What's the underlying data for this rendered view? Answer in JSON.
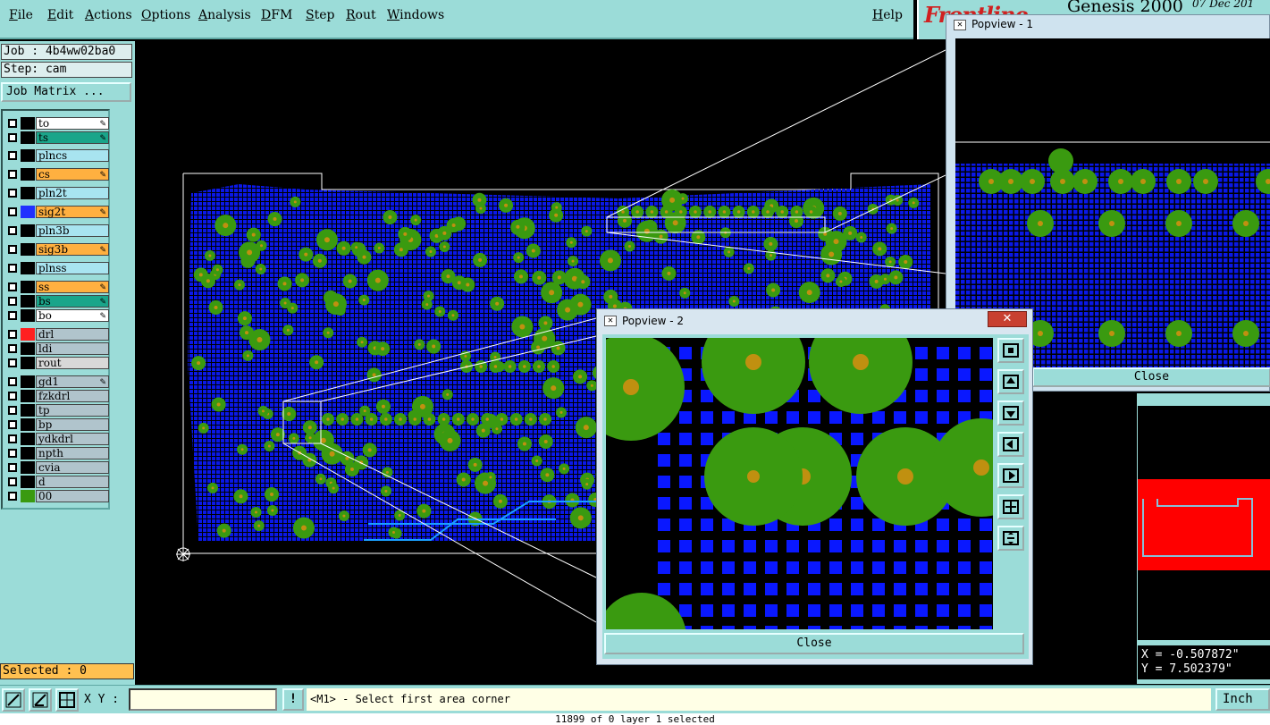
{
  "menubar": {
    "menus": [
      "File",
      "Edit",
      "Actions",
      "Options",
      "Analysis",
      "DFM",
      "Step",
      "Rout",
      "Windows"
    ],
    "help": "Help"
  },
  "brand": {
    "logo": "Frontline",
    "product": "Genesis 2000",
    "date": "07 Dec 201"
  },
  "job": {
    "label": "Job : 4b4ww02ba0",
    "step": "Step: cam",
    "matrix_button": "Job Matrix ..."
  },
  "layers": [
    {
      "name": "to",
      "color": "#ffffff",
      "swatch": "#000000",
      "pen": true
    },
    {
      "name": "ts",
      "color": "#1aa58a",
      "swatch": "#000000",
      "pen": true
    },
    {
      "name": "plncs",
      "color": "#a8e4f0",
      "swatch": "#000000",
      "pen": false
    },
    {
      "name": "cs",
      "color": "#ffb040",
      "swatch": "#000000",
      "pen": true
    },
    {
      "name": "pln2t",
      "color": "#a8e4f0",
      "swatch": "#000000",
      "pen": false
    },
    {
      "name": "sig2t",
      "color": "#ffb040",
      "swatch": "#2030ff",
      "pen": true
    },
    {
      "name": "pln3b",
      "color": "#a8e4f0",
      "swatch": "#000000",
      "pen": false
    },
    {
      "name": "sig3b",
      "color": "#ffb040",
      "swatch": "#000000",
      "pen": true
    },
    {
      "name": "plnss",
      "color": "#a8e4f0",
      "swatch": "#000000",
      "pen": false
    },
    {
      "name": "ss",
      "color": "#ffb040",
      "swatch": "#000000",
      "pen": true
    },
    {
      "name": "bs",
      "color": "#1aa58a",
      "swatch": "#000000",
      "pen": true
    },
    {
      "name": "bo",
      "color": "#ffffff",
      "swatch": "#000000",
      "pen": true
    },
    {
      "name": "drl",
      "color": "#b0c4cc",
      "swatch": "#ff2020",
      "pen": false
    },
    {
      "name": "ldi",
      "color": "#b0c4cc",
      "swatch": "#000000",
      "pen": false
    },
    {
      "name": "rout",
      "color": "#d8d8d8",
      "swatch": "#000000",
      "pen": false
    },
    {
      "name": "gd1",
      "color": "#b0c4cc",
      "swatch": "#000000",
      "pen": true
    },
    {
      "name": "fzkdrl",
      "color": "#b0c4cc",
      "swatch": "#000000",
      "pen": false
    },
    {
      "name": "tp",
      "color": "#b0c4cc",
      "swatch": "#000000",
      "pen": false
    },
    {
      "name": "bp",
      "color": "#b0c4cc",
      "swatch": "#000000",
      "pen": false
    },
    {
      "name": "ydkdrl",
      "color": "#b0c4cc",
      "swatch": "#000000",
      "pen": false
    },
    {
      "name": "npth",
      "color": "#b0c4cc",
      "swatch": "#000000",
      "pen": false
    },
    {
      "name": "cvia",
      "color": "#b0c4cc",
      "swatch": "#000000",
      "pen": false
    },
    {
      "name": "d",
      "color": "#b0c4cc",
      "swatch": "#000000",
      "pen": false
    },
    {
      "name": "00",
      "color": "#b0c4cc",
      "swatch": "#3a9a10",
      "pen": false
    }
  ],
  "selected": "Selected : 0",
  "popview1": {
    "title": "Popview - 1",
    "close": "Close"
  },
  "popview2": {
    "title": "Popview - 2",
    "close": "Close",
    "x_label": "✕"
  },
  "coords": {
    "x": "X = -0.507872\"",
    "y": "Y = 7.502379\""
  },
  "bottombar": {
    "xy_label": "X Y :",
    "xy_value": "",
    "warn": "!",
    "prompt": "<M1> - Select first area corner",
    "units": "Inch"
  },
  "statusline": "11899 of 0 layer 1 selected",
  "colors": {
    "panel": "#9bdcd8",
    "copper": "#0a18e8",
    "pad": "#3a9a10",
    "drill": "#c09010",
    "selection": "#ffb040"
  }
}
